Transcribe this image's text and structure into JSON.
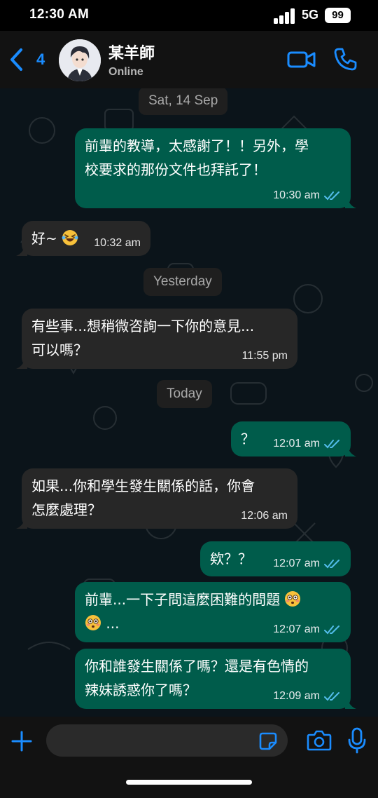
{
  "status_bar": {
    "time": "12:30 AM",
    "network": "5G",
    "battery": "99"
  },
  "header": {
    "back_count": "4",
    "contact_name": "某羊師",
    "contact_status": "Online",
    "icons": {
      "back": "chevron-left-icon",
      "video": "video-camera-icon",
      "call": "phone-icon"
    }
  },
  "chat": {
    "dates": {
      "d1": "Sat, 14 Sep",
      "d2": "Yesterday",
      "d3": "Today"
    },
    "messages": [
      {
        "direction": "out",
        "lines": [
          "前輩的教導，太感謝了！！另外，學",
          "校要求的那份文件也拜託了！"
        ],
        "time": "10:30 am",
        "read": true
      },
      {
        "direction": "in",
        "text": "好~",
        "emoji": "grinning-squinting-face-with-tears",
        "time": "10:32 am"
      },
      {
        "direction": "in",
        "lines": [
          "有些事...想稍微咨詢一下你的意見...",
          "可以嗎？"
        ],
        "time": "11:55 pm"
      },
      {
        "direction": "out",
        "text": "？",
        "time": "12:01 am",
        "read": true
      },
      {
        "direction": "in",
        "lines": [
          "如果...你和學生發生關係的話，你會",
          "怎麼處理？"
        ],
        "time": "12:06 am"
      },
      {
        "direction": "out",
        "text": "欸？？",
        "time": "12:07 am",
        "read": true
      },
      {
        "direction": "out",
        "text": "前輩...一下子問這麼困難的問題",
        "text2": "...",
        "emoji": "flushed-face",
        "time": "12:07 am",
        "read": true
      },
      {
        "direction": "out",
        "lines": [
          "你和誰發生關係了嗎？還是有色情的",
          "辣妹誘惑你了嗎？"
        ],
        "time": "12:09 am",
        "read": true
      }
    ]
  },
  "composer": {
    "input_value": "",
    "icons": {
      "plus": "plus-icon",
      "sticker": "sticker-icon",
      "camera": "camera-icon",
      "mic": "microphone-icon"
    }
  },
  "colors": {
    "accent": "#1a8cff",
    "outgoing": "#005c4b",
    "incoming": "#272727",
    "read_tick": "#53bdeb"
  }
}
